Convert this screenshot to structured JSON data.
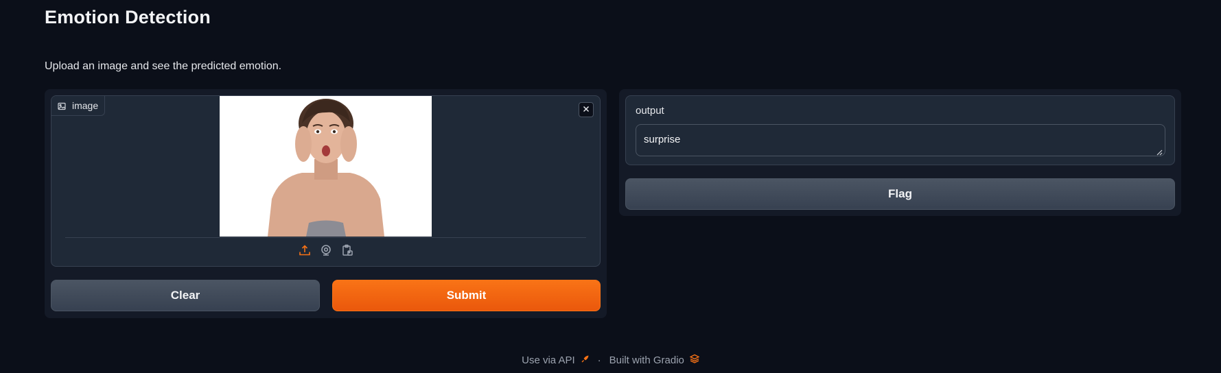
{
  "header": {
    "title": "Emotion Detection",
    "description": "Upload an image and see the predicted emotion."
  },
  "input": {
    "image_label": "image",
    "image_icon": "image-icon",
    "close_icon": "close-icon",
    "sources": [
      "upload-icon",
      "webcam-icon",
      "clipboard-icon"
    ],
    "accent_color": "#f97316"
  },
  "actions": {
    "clear_label": "Clear",
    "submit_label": "Submit",
    "flag_label": "Flag"
  },
  "output": {
    "label": "output",
    "value": "surprise"
  },
  "footer": {
    "api_label": "Use via API",
    "separator": "·",
    "built_label": "Built with Gradio"
  }
}
